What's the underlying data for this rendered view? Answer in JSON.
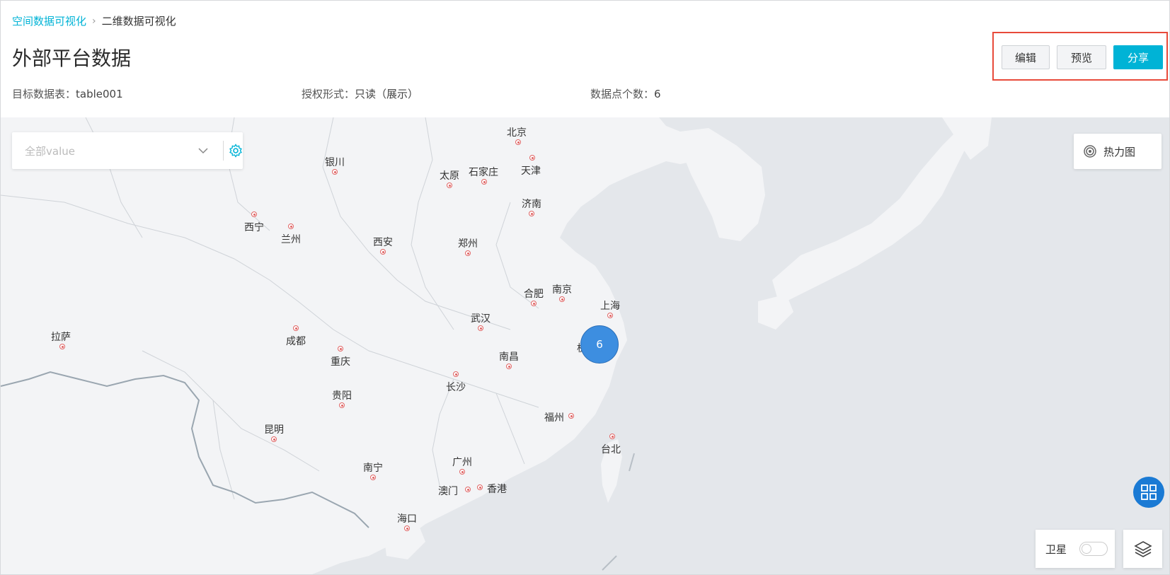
{
  "breadcrumb": {
    "parent": "空间数据可视化",
    "current": "二维数据可视化"
  },
  "page": {
    "title": "外部平台数据"
  },
  "meta": {
    "table_label": "目标数据表：",
    "table_value": "table001",
    "auth_label": "授权形式：",
    "auth_value": "只读（展示）",
    "count_label": "数据点个数：",
    "count_value": "6"
  },
  "actions": {
    "edit": "编辑",
    "preview": "预览",
    "share": "分享"
  },
  "filter": {
    "placeholder": "全部value"
  },
  "heatmap": {
    "label": "热力图"
  },
  "satellite": {
    "label": "卫星",
    "on": false
  },
  "cluster": {
    "count": "6"
  },
  "colors": {
    "accent": "#00b3d6",
    "cluster": "#3d8ee0",
    "highlight": "#e84a3a"
  },
  "cities": [
    {
      "name": "北京"
    },
    {
      "name": "天津"
    },
    {
      "name": "石家庄"
    },
    {
      "name": "太原"
    },
    {
      "name": "银川"
    },
    {
      "name": "济南"
    },
    {
      "name": "西宁"
    },
    {
      "name": "兰州"
    },
    {
      "name": "西安"
    },
    {
      "name": "郑州"
    },
    {
      "name": "合肥"
    },
    {
      "name": "南京"
    },
    {
      "name": "上海"
    },
    {
      "name": "杭州"
    },
    {
      "name": "武汉"
    },
    {
      "name": "拉萨"
    },
    {
      "name": "成都"
    },
    {
      "name": "重庆"
    },
    {
      "name": "南昌"
    },
    {
      "name": "长沙"
    },
    {
      "name": "贵阳"
    },
    {
      "name": "福州"
    },
    {
      "name": "台北"
    },
    {
      "name": "昆明"
    },
    {
      "name": "南宁"
    },
    {
      "name": "广州"
    },
    {
      "name": "澳门"
    },
    {
      "name": "香港"
    },
    {
      "name": "海口"
    }
  ]
}
